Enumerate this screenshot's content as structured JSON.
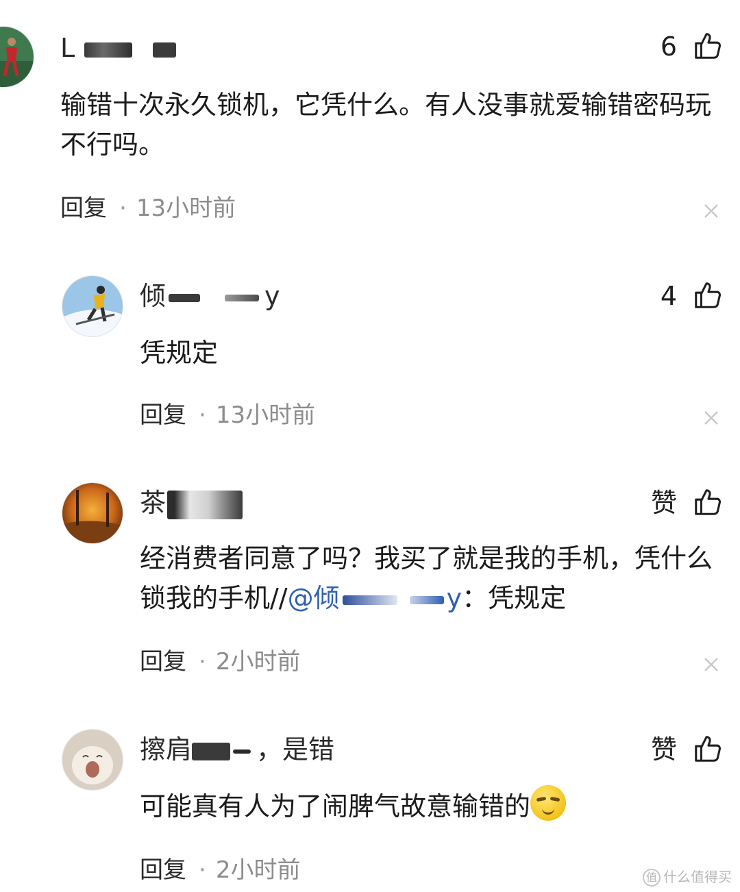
{
  "comments": [
    {
      "username": "L",
      "likes": "6",
      "text": "输错十次永久锁机，它凭什么。有人没事就爱输错密码玩不行吗。",
      "reply_label": "回复",
      "dot": "·",
      "time": "13小时前"
    },
    {
      "username_prefix": "倾",
      "username_suffix": "y",
      "likes": "4",
      "text": "凭规定",
      "reply_label": "回复",
      "dot": "·",
      "time": "13小时前"
    },
    {
      "username": "茶",
      "likes": "赞",
      "text_before": "经消费者同意了吗？我买了就是我的手机，凭什么锁我的手机//",
      "mention": "@倾",
      "mention_suffix": "y",
      "text_after": "：凭规定",
      "reply_label": "回复",
      "dot": "·",
      "time": "2小时前"
    },
    {
      "username_prefix": "擦肩",
      "username_suffix": "，是错",
      "likes": "赞",
      "text": "可能真有人为了闹脾气故意输错的",
      "reply_label": "回复",
      "dot": "·",
      "time": "2小时前"
    }
  ],
  "watermark": {
    "icon_glyph": "值",
    "text": "什么值得买"
  }
}
